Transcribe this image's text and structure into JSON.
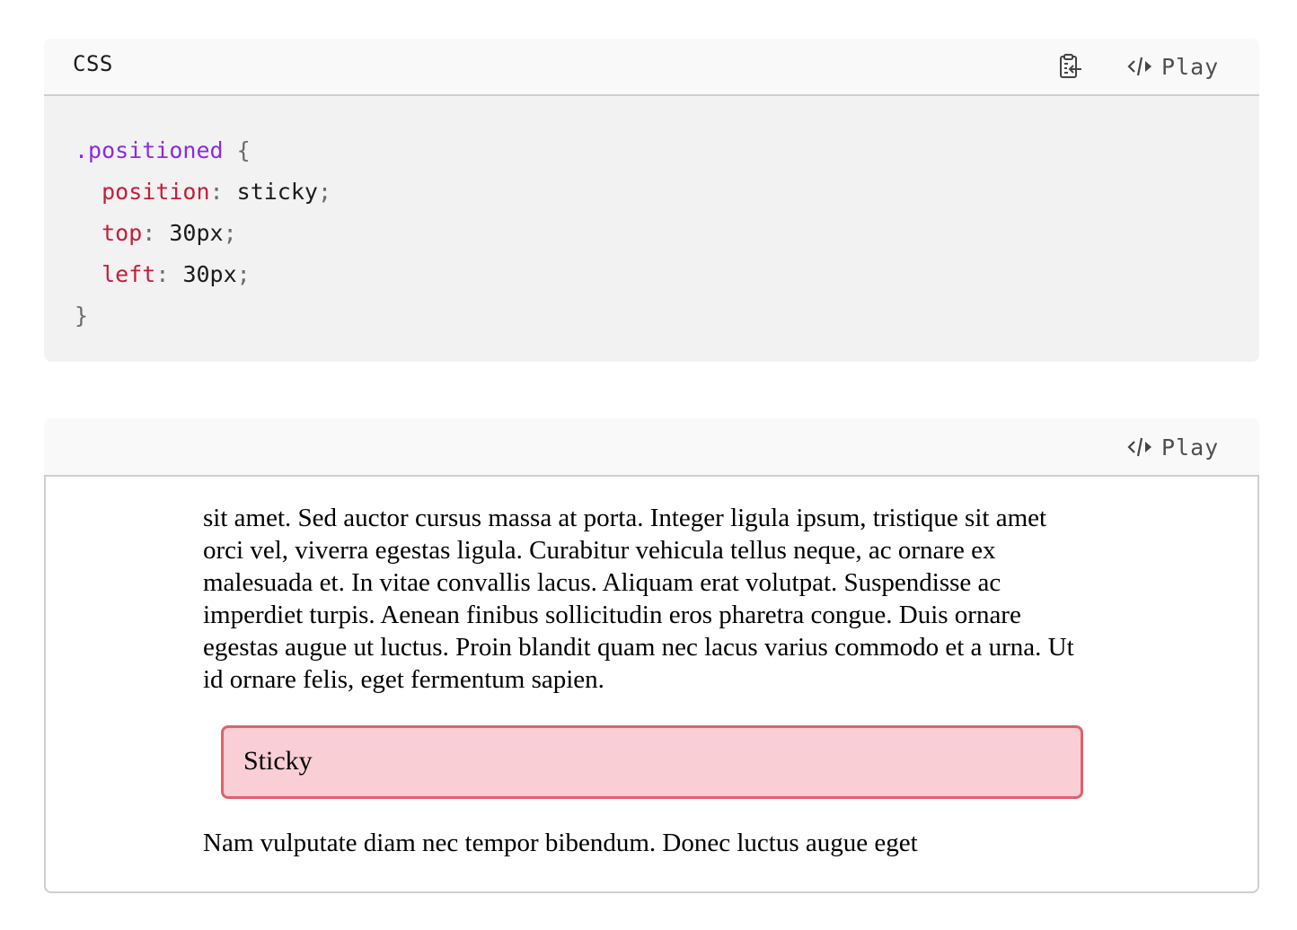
{
  "code_block": {
    "language": "CSS",
    "copy_icon": "clipboard-copy-icon",
    "play_icon": "code-icon",
    "play_label": "Play",
    "lines": [
      [
        {
          "t": "sel",
          "v": ".positioned"
        },
        {
          "t": "punc",
          "v": " {"
        }
      ],
      [
        {
          "t": "plain",
          "v": "  "
        },
        {
          "t": "prop",
          "v": "position"
        },
        {
          "t": "punc",
          "v": ":"
        },
        {
          "t": "val",
          "v": " sticky"
        },
        {
          "t": "punc",
          "v": ";"
        }
      ],
      [
        {
          "t": "plain",
          "v": "  "
        },
        {
          "t": "prop",
          "v": "top"
        },
        {
          "t": "punc",
          "v": ":"
        },
        {
          "t": "val",
          "v": " 30px"
        },
        {
          "t": "punc",
          "v": ";"
        }
      ],
      [
        {
          "t": "plain",
          "v": "  "
        },
        {
          "t": "prop",
          "v": "left"
        },
        {
          "t": "punc",
          "v": ":"
        },
        {
          "t": "val",
          "v": " 30px"
        },
        {
          "t": "punc",
          "v": ";"
        }
      ],
      [
        {
          "t": "punc",
          "v": "}"
        }
      ]
    ]
  },
  "example": {
    "play_icon": "code-icon",
    "play_label": "Play",
    "paragraph_top": "sit amet. Sed auctor cursus massa at porta. Integer ligula ipsum, tristique sit amet orci vel, viverra egestas ligula. Curabitur vehicula tellus neque, ac ornare ex malesuada et. In vitae convallis lacus. Aliquam erat volutpat. Suspendisse ac imperdiet turpis. Aenean finibus sollicitudin eros pharetra congue. Duis ornare egestas augue ut luctus. Proin blandit quam nec lacus varius commodo et a urna. Ut id ornare felis, eget fermentum sapien.",
    "sticky_label": "Sticky",
    "paragraph_bottom": "Nam vulputate diam nec tempor bibendum. Donec luctus augue eget"
  },
  "colors": {
    "selector": "#8a2be2",
    "property": "#c51d3b",
    "sticky_background": "#f9ced5",
    "sticky_border": "#e0606e"
  }
}
